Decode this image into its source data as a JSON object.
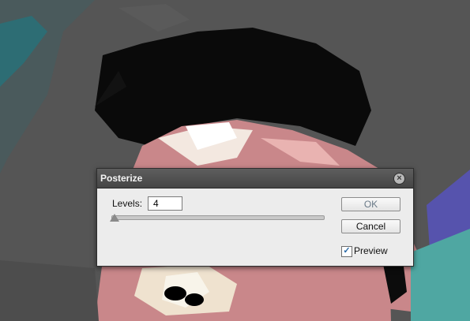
{
  "dialog": {
    "title": "Posterize",
    "levels_label": "Levels:",
    "levels_value": "4",
    "ok_label": "OK",
    "cancel_label": "Cancel",
    "preview_label": "Preview",
    "preview_checked": true,
    "check_glyph": "✓",
    "close_glyph": "×"
  },
  "colors": {
    "canvas_background": "#545454",
    "dialog_background": "#ececec",
    "titlebar": "#505050"
  }
}
